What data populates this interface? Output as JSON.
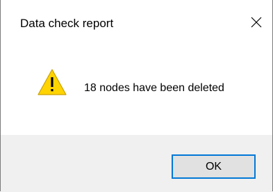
{
  "window": {
    "title": "Data check report"
  },
  "content": {
    "icon": "warning-icon",
    "message": "18 nodes have been deleted"
  },
  "footer": {
    "ok_label": "OK"
  },
  "colors": {
    "warning_fill": "#ffd400",
    "accent_border": "#0078d7",
    "footer_bg": "#f0f0f0"
  }
}
